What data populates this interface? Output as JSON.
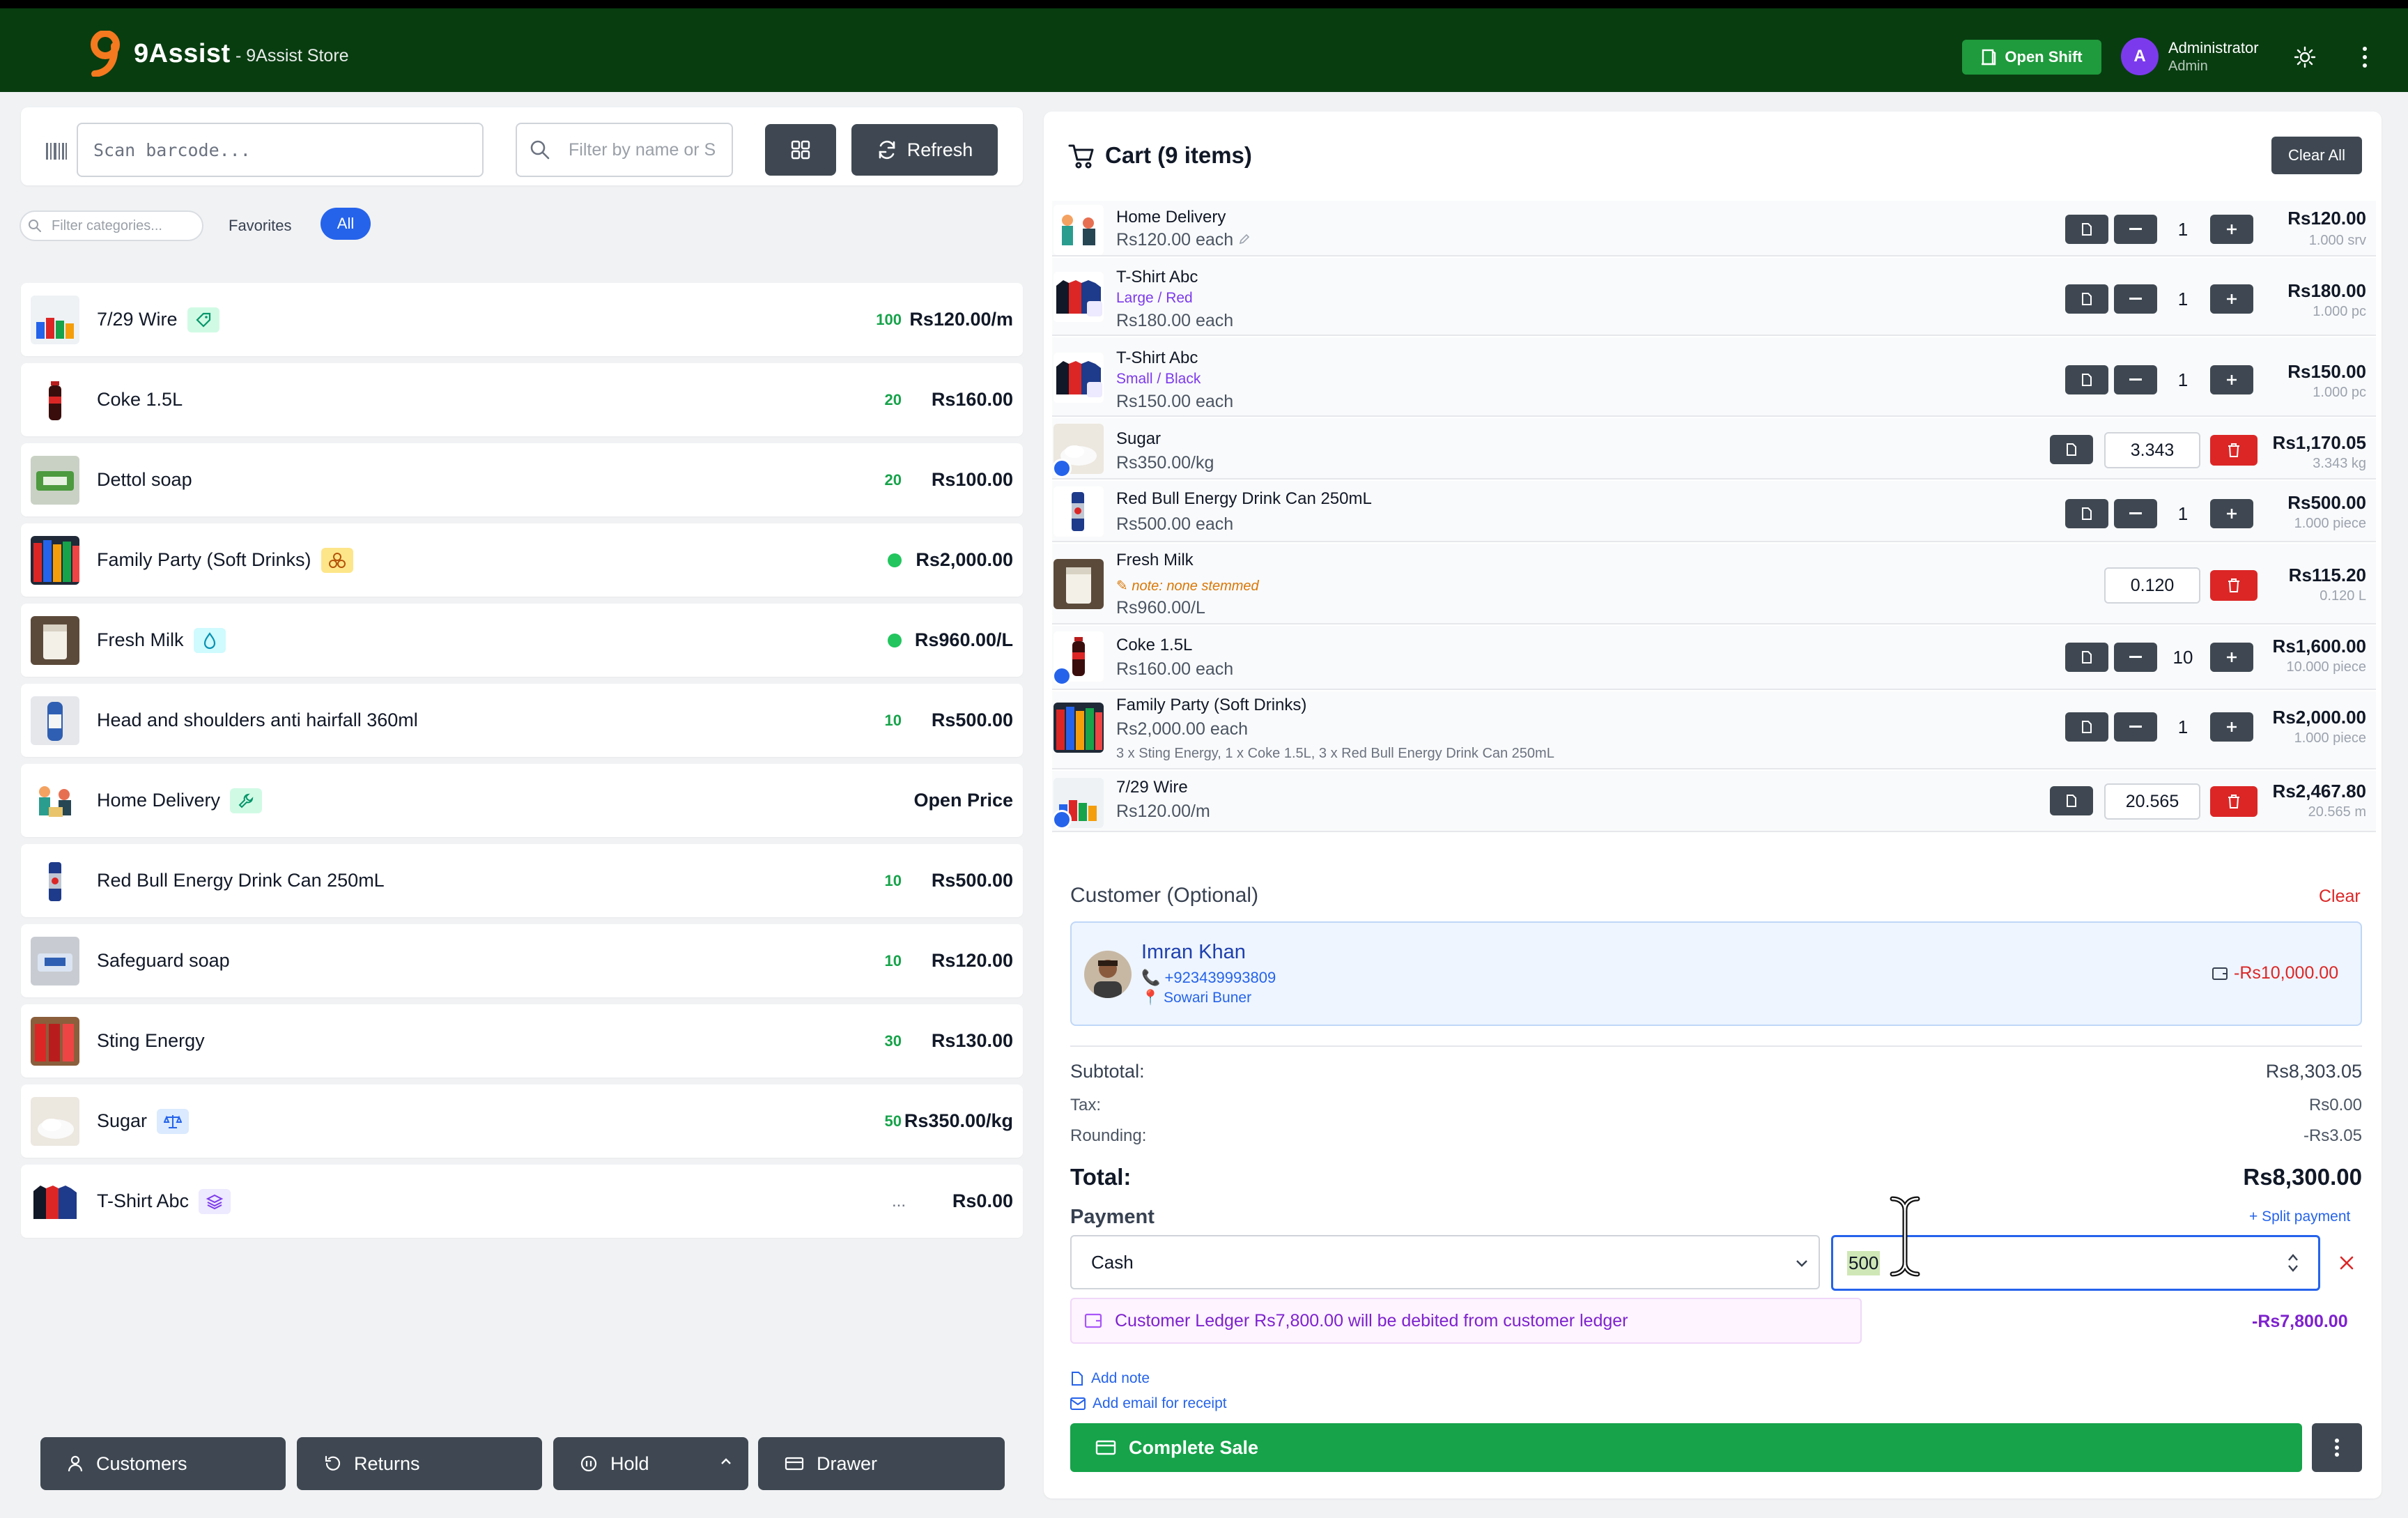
{
  "header": {
    "brand": "9Assist",
    "store": "- 9Assist Store",
    "open_shift": "Open Shift",
    "avatar_letter": "A",
    "user_name": "Administrator",
    "user_role": "Admin"
  },
  "toolbar": {
    "scan_placeholder": "Scan barcode...",
    "filter_placeholder": "Filter by name or S",
    "refresh_label": "Refresh"
  },
  "categories": {
    "filter_placeholder": "Filter categories...",
    "favorites": "Favorites",
    "all": "All"
  },
  "products": [
    {
      "name": "7/29 Wire",
      "stock": "100",
      "price": "Rs120.00/m",
      "badge": "tag"
    },
    {
      "name": "Coke 1.5L",
      "stock": "20",
      "price": "Rs160.00"
    },
    {
      "name": "Dettol soap",
      "stock": "20",
      "price": "Rs100.00"
    },
    {
      "name": "Family Party (Soft Drinks)",
      "price": "Rs2,000.00",
      "badge": "combo"
    },
    {
      "name": "Fresh Milk",
      "price": "Rs960.00/L",
      "badge": "liquid"
    },
    {
      "name": "Head and shoulders anti hairfall 360ml",
      "stock": "10",
      "price": "Rs500.00"
    },
    {
      "name": "Home Delivery",
      "price": "Open Price",
      "badge": "service"
    },
    {
      "name": "Red Bull Energy Drink Can 250mL",
      "stock": "10",
      "price": "Rs500.00"
    },
    {
      "name": "Safeguard soap",
      "stock": "10",
      "price": "Rs120.00"
    },
    {
      "name": "Sting Energy",
      "stock": "30",
      "price": "Rs130.00"
    },
    {
      "name": "Sugar",
      "stock": "50",
      "price": "Rs350.00/kg",
      "badge": "scale"
    },
    {
      "name": "T-Shirt Abc",
      "stock": "...",
      "price": "Rs0.00",
      "badge": "variant"
    }
  ],
  "bottom_bar": {
    "customers": "Customers",
    "returns": "Returns",
    "hold": "Hold",
    "drawer": "Drawer"
  },
  "cart": {
    "title": "Cart (9 items)",
    "clear_all": "Clear All",
    "items": [
      {
        "name": "Home Delivery",
        "price": "Rs120.00 each",
        "qty": "1",
        "total": "Rs120.00",
        "unit": "1.000 srv"
      },
      {
        "name": "T-Shirt Abc",
        "variant": "Large / Red",
        "price": "Rs180.00 each",
        "qty": "1",
        "total": "Rs180.00",
        "unit": "1.000 pc"
      },
      {
        "name": "T-Shirt Abc",
        "variant": "Small / Black",
        "price": "Rs150.00 each",
        "qty": "1",
        "total": "Rs150.00",
        "unit": "1.000 pc"
      },
      {
        "name": "Sugar",
        "price": "Rs350.00/kg",
        "qty": "3.343",
        "total": "Rs1,170.05",
        "unit": "3.343 kg"
      },
      {
        "name": "Red Bull Energy Drink Can 250mL",
        "price": "Rs500.00 each",
        "qty": "1",
        "total": "Rs500.00",
        "unit": "1.000 piece"
      },
      {
        "name": "Fresh Milk",
        "note": "note: none stemmed",
        "price": "Rs960.00/L",
        "qty": "0.120",
        "total": "Rs115.20",
        "unit": "0.120 L"
      },
      {
        "name": "Coke 1.5L",
        "price": "Rs160.00 each",
        "qty": "10",
        "total": "Rs1,600.00",
        "unit": "10.000 piece"
      },
      {
        "name": "Family Party (Soft Drinks)",
        "price": "Rs2,000.00 each",
        "combo": "3 x Sting Energy, 1 x Coke 1.5L, 3 x Red Bull Energy Drink Can 250mL",
        "qty": "1",
        "total": "Rs2,000.00",
        "unit": "1.000 piece"
      },
      {
        "name": "7/29 Wire",
        "price": "Rs120.00/m",
        "qty": "20.565",
        "total": "Rs2,467.80",
        "unit": "20.565 m"
      }
    ]
  },
  "customer": {
    "label": "Customer (Optional)",
    "clear": "Clear",
    "name": "Imran Khan",
    "phone": "+923439993809",
    "address": "Sowari Buner",
    "balance": "-Rs10,000.00"
  },
  "summary": {
    "subtotal_label": "Subtotal:",
    "subtotal": "Rs8,303.05",
    "tax_label": "Tax:",
    "tax": "Rs0.00",
    "rounding_label": "Rounding:",
    "rounding": "-Rs3.05",
    "total_label": "Total:",
    "total": "Rs8,300.00"
  },
  "payment": {
    "label": "Payment",
    "split": "+ Split payment",
    "method": "Cash",
    "amount": "500",
    "ledger_message": "Customer Ledger Rs7,800.00 will be debited from customer ledger",
    "ledger_amount": "-Rs7,800.00",
    "add_note": "Add note",
    "add_email": "Add email for receipt",
    "complete": "Complete Sale"
  },
  "colors": {
    "header": "#083d10",
    "primary": "#2563eb",
    "success": "#16a34a",
    "danger": "#dc2626",
    "dark_button": "#3f4852",
    "ledger": "#7e22ce"
  }
}
